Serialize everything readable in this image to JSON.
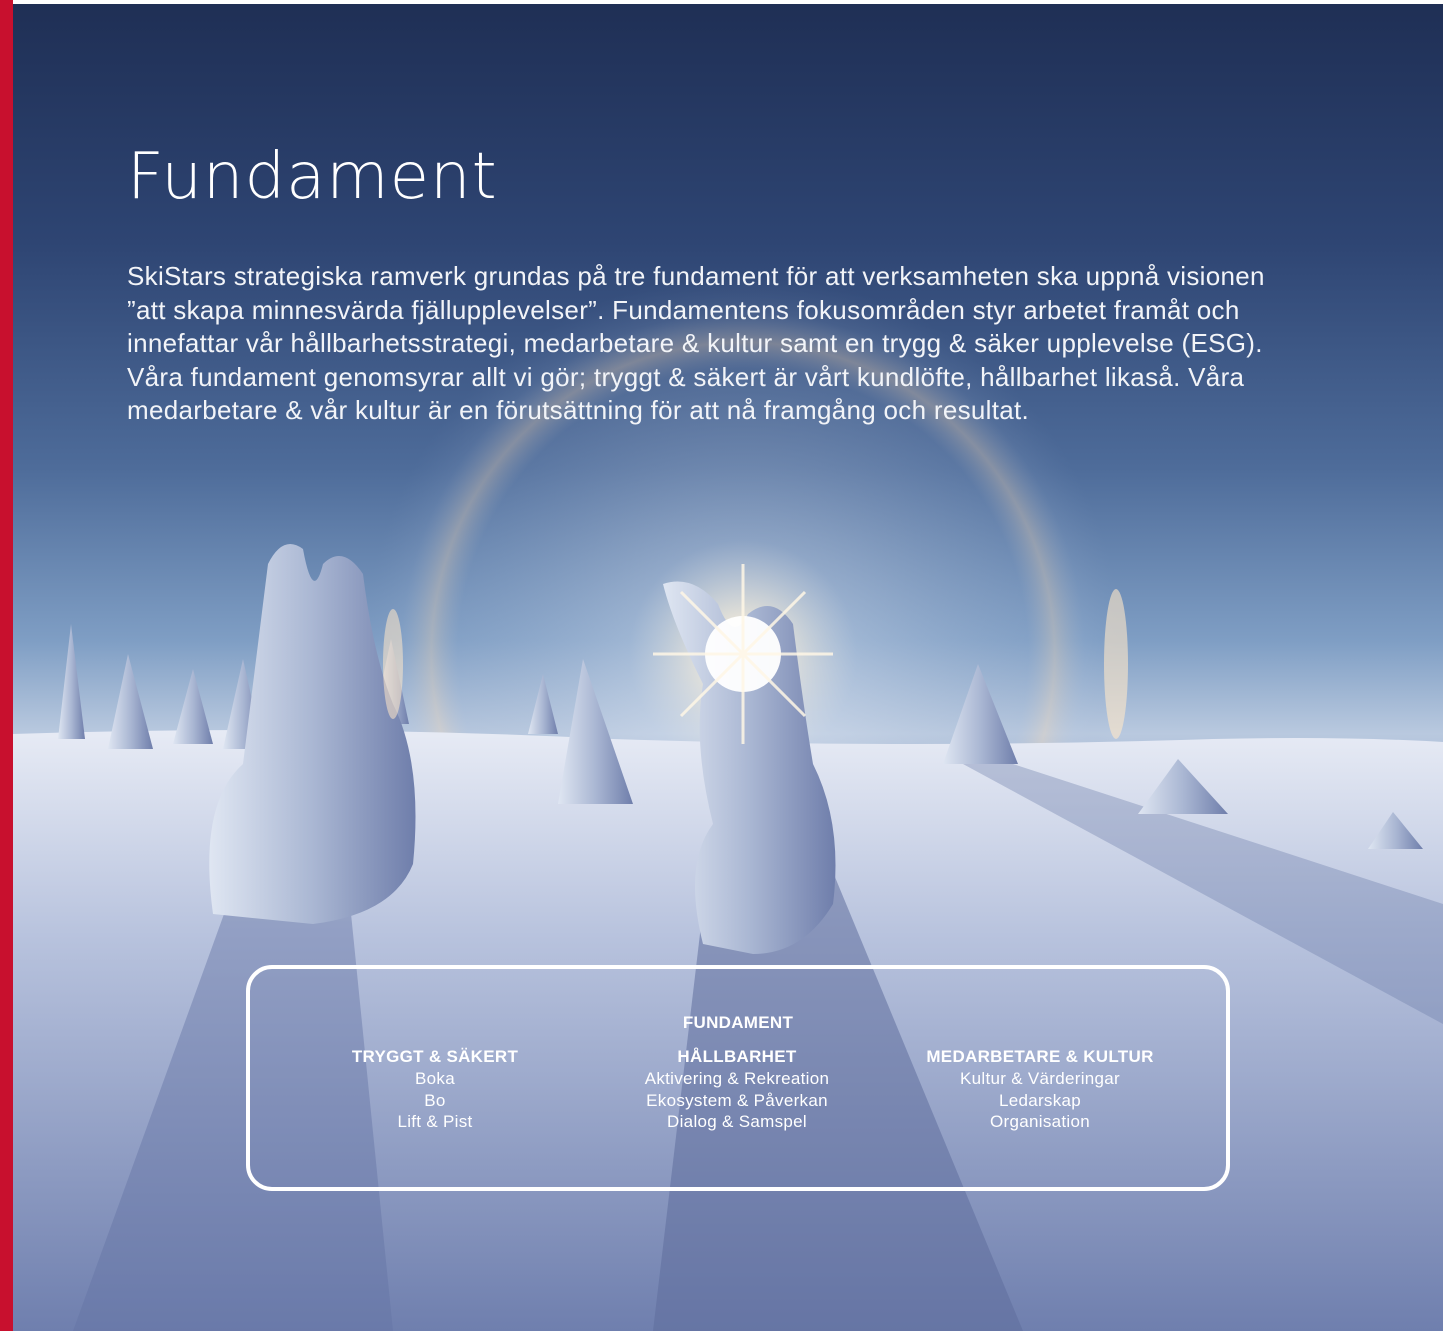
{
  "page": {
    "title": "Fundament",
    "intro": "SkiStars strategiska ramverk grundas på tre fundament för att verksamheten ska uppnå visionen ”att skapa minnesvärda fjällupplevelser”. Fundamentens fokusområden styr arbetet framåt och innefattar vår hållbarhetsstrategi, medarbetare & kultur samt en trygg & säker upplevelse (ESG). Våra fundament genomsyrar allt vi gör; tryggt & säkert är vårt kundlöfte, hållbarhet likaså. Våra medarbetare & vår kultur är en förutsättning för att nå framgång och resultat."
  },
  "fundament_box": {
    "heading": "FUNDAMENT",
    "columns": [
      {
        "title": "TRYGGT & SÄKERT",
        "items": [
          "Boka",
          "Bo",
          "Lift & Pist"
        ]
      },
      {
        "title": "HÅLLBARHET",
        "items": [
          "Aktivering & Rekreation",
          "Ekosystem & Påverkan",
          "Dialog & Samspel"
        ]
      },
      {
        "title": "MEDARBETARE & KULTUR",
        "items": [
          "Kultur & Värderingar",
          "Ledarskap",
          "Organisation"
        ]
      }
    ]
  },
  "colors": {
    "accent_bar": "#c8102e",
    "text": "#ffffff"
  }
}
